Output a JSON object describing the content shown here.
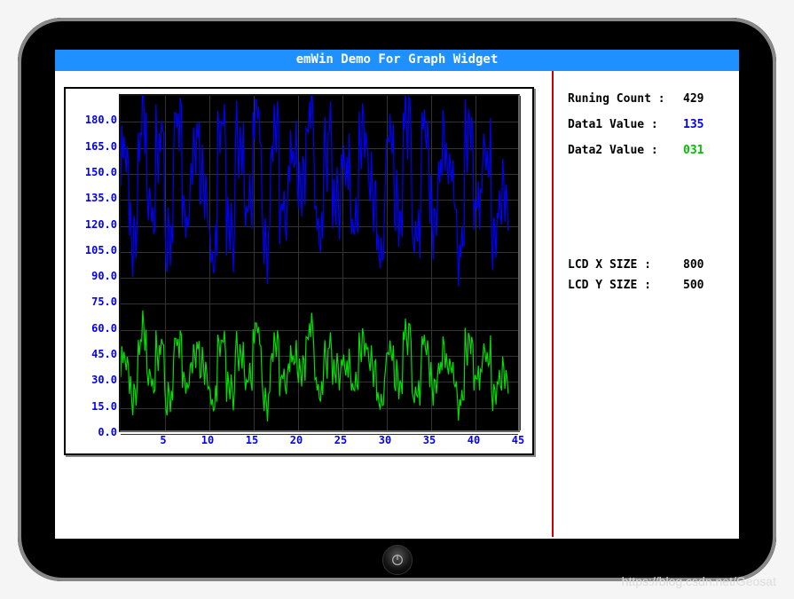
{
  "title": "emWin Demo For Graph Widget",
  "info": {
    "running_count_label": "Runing Count :",
    "running_count_value": "429",
    "data1_label": "Data1 Value  :",
    "data1_value": "135",
    "data2_label": "Data2 Value  :",
    "data2_value": "031",
    "lcd_x_label": "LCD X SIZE :",
    "lcd_x_value": "800",
    "lcd_y_label": "LCD Y SIZE :",
    "lcd_y_value": "500"
  },
  "watermark": "https://blog.csdn.net/Geosat",
  "chart_data": {
    "type": "line",
    "title": "",
    "xlabel": "",
    "ylabel": "",
    "ylim": [
      0,
      195
    ],
    "xlim": [
      0,
      45
    ],
    "y_ticks": [
      "0.0",
      "15.0",
      "30.0",
      "45.0",
      "60.0",
      "75.0",
      "90.0",
      "105.0",
      "120.0",
      "135.0",
      "150.0",
      "165.0",
      "180.0"
    ],
    "x_ticks": [
      "5",
      "10",
      "15",
      "20",
      "25",
      "30",
      "35",
      "40",
      "45"
    ],
    "series": [
      {
        "name": "Data1",
        "color": "#0000ff",
        "note": "noisy waveform oscillating approx 105–185, current value 135",
        "x": [
          0,
          1,
          2,
          3,
          4,
          5,
          6,
          7,
          8,
          9,
          10,
          11,
          12,
          13,
          14,
          15,
          16,
          17,
          18,
          19,
          20,
          21,
          22,
          23,
          24,
          25,
          26,
          27,
          28,
          29,
          30,
          31,
          32,
          33,
          34,
          35,
          36,
          37,
          38,
          39,
          40,
          41,
          42,
          43
        ],
        "values": [
          160,
          115,
          178,
          130,
          170,
          110,
          182,
          125,
          168,
          140,
          108,
          175,
          120,
          165,
          135,
          180,
          112,
          172,
          128,
          160,
          145,
          183,
          118,
          170,
          132,
          158,
          122,
          176,
          140,
          110,
          168,
          130,
          180,
          115,
          172,
          126,
          162,
          150,
          108,
          174,
          134,
          160,
          120,
          135
        ]
      },
      {
        "name": "Data2",
        "color": "#00e000",
        "note": "noisy waveform oscillating approx 15–60, current value 31",
        "x": [
          0,
          1,
          2,
          3,
          4,
          5,
          6,
          7,
          8,
          9,
          10,
          11,
          12,
          13,
          14,
          15,
          16,
          17,
          18,
          19,
          20,
          21,
          22,
          23,
          24,
          25,
          26,
          27,
          28,
          29,
          30,
          31,
          32,
          33,
          34,
          35,
          36,
          37,
          38,
          39,
          40,
          41,
          42,
          43
        ],
        "values": [
          40,
          22,
          55,
          30,
          48,
          18,
          52,
          28,
          46,
          35,
          20,
          50,
          26,
          44,
          32,
          56,
          19,
          48,
          30,
          42,
          36,
          58,
          24,
          46,
          34,
          40,
          27,
          52,
          38,
          20,
          44,
          30,
          55,
          22,
          48,
          28,
          42,
          36,
          18,
          50,
          32,
          44,
          25,
          31
        ]
      }
    ]
  }
}
